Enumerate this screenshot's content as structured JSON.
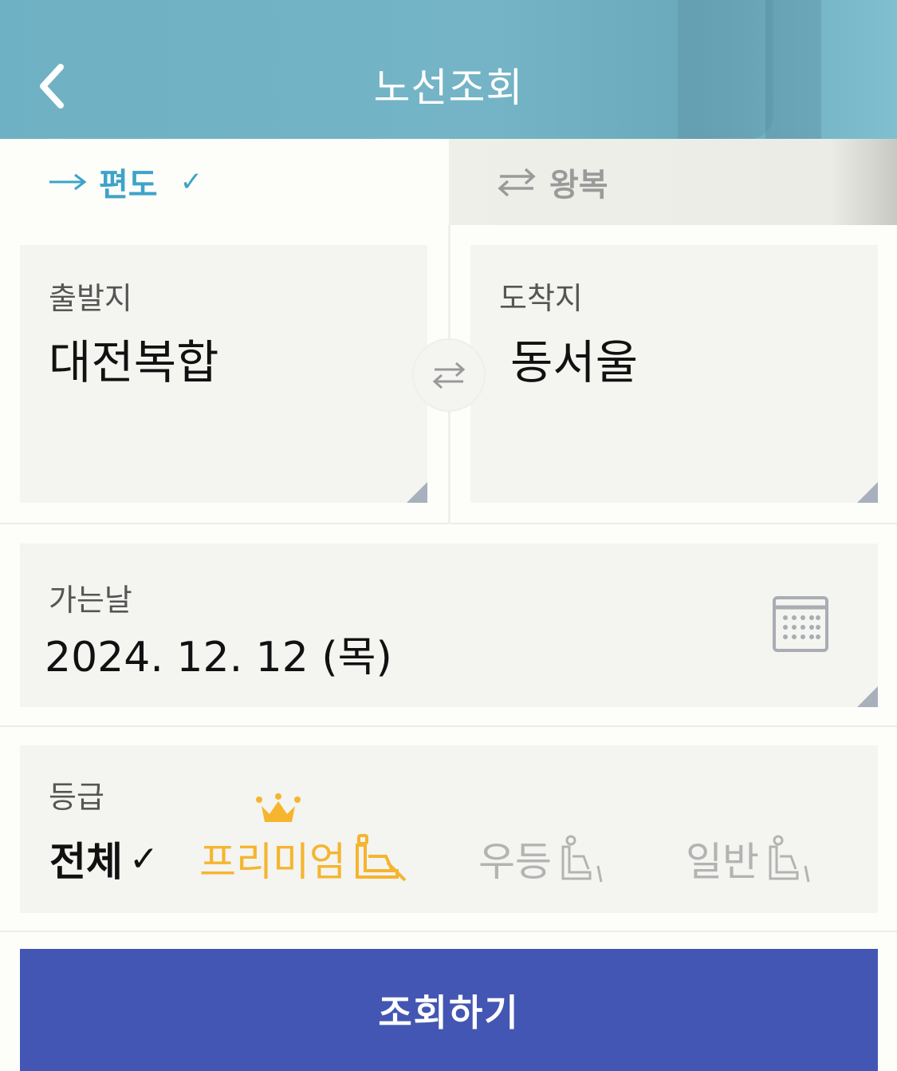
{
  "header": {
    "title": "노선조회",
    "back_icon": "chevron-left-icon"
  },
  "tabs": {
    "oneway": {
      "label": "편도",
      "check": "✓",
      "selected": true,
      "color": "#3ea3c9"
    },
    "roundtrip": {
      "label": "왕복",
      "selected": false,
      "color": "#9a9a9a"
    }
  },
  "stations": {
    "departure": {
      "label": "출발지",
      "value": "대전복합"
    },
    "arrival": {
      "label": "도착지",
      "value": "동서울"
    }
  },
  "date": {
    "label": "가는날",
    "value": "2024. 12. 12 (목)"
  },
  "grade": {
    "label": "등급",
    "options": [
      {
        "label": "전체",
        "check": "✓",
        "selected": true
      },
      {
        "label": "프리미엄",
        "color": "#f5b52e"
      },
      {
        "label": "우등",
        "color": "#b3b3b3"
      },
      {
        "label": "일반",
        "color": "#b3b3b3"
      }
    ]
  },
  "search_button": {
    "label": "조회하기",
    "color": "#4356b3"
  }
}
